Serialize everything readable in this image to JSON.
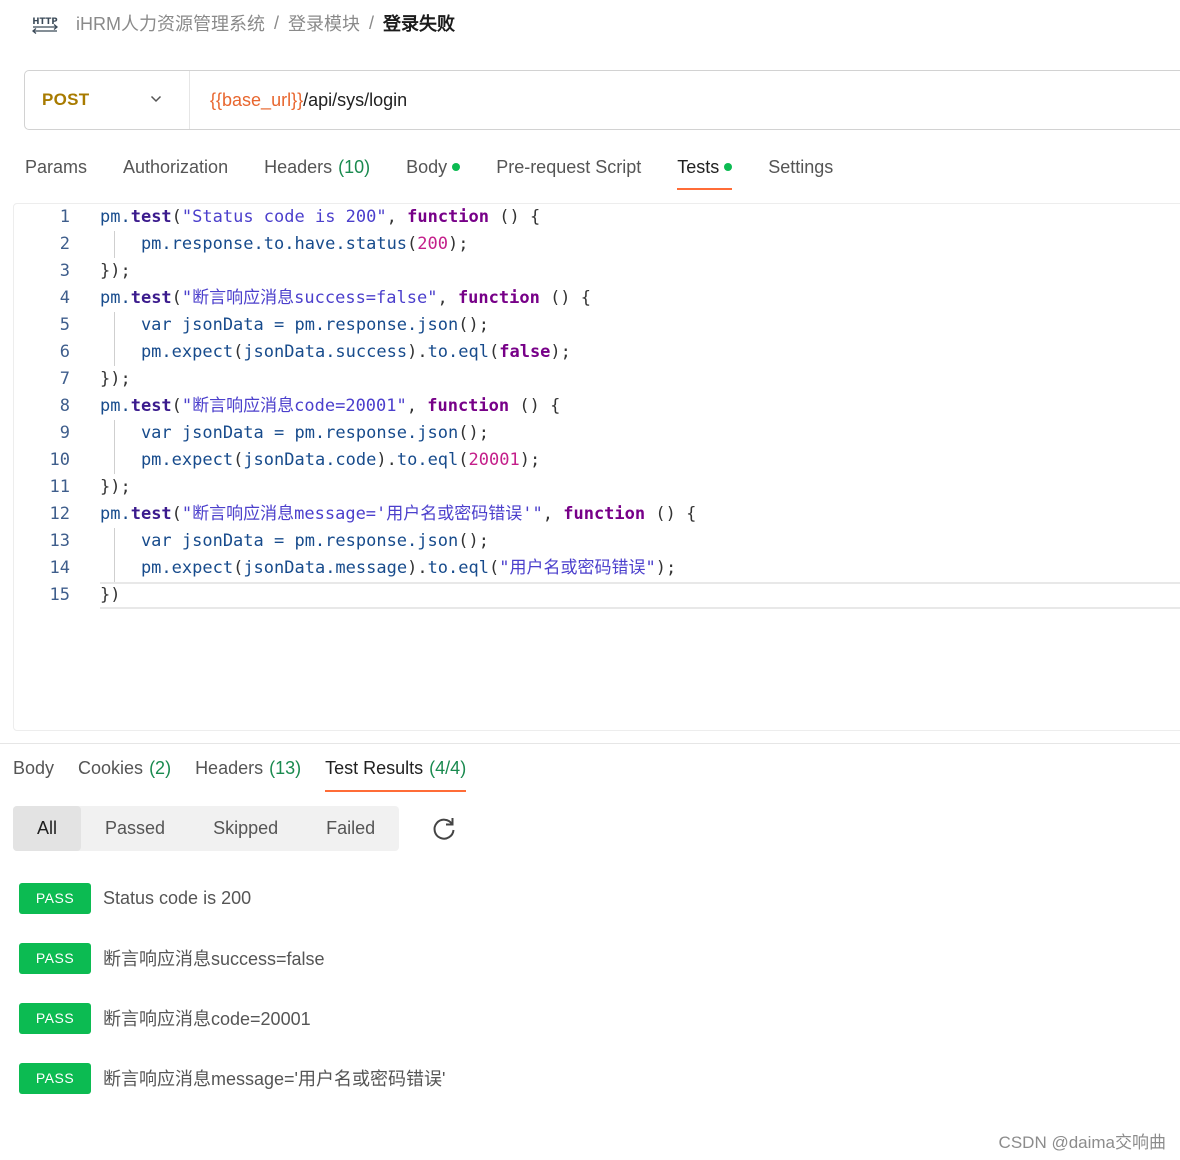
{
  "breadcrumb": {
    "icon": "http-icon",
    "items": [
      "iHRM人力资源管理系统",
      "登录模块"
    ],
    "separator": "/",
    "current": "登录失败"
  },
  "request": {
    "method": "POST",
    "url_variable": "{{base_url}}",
    "url_path": "/api/sys/login"
  },
  "request_tabs": [
    {
      "label": "Params"
    },
    {
      "label": "Authorization"
    },
    {
      "label": "Headers",
      "count": "(10)"
    },
    {
      "label": "Body",
      "dot": true
    },
    {
      "label": "Pre-request Script"
    },
    {
      "label": "Tests",
      "dot": true,
      "active": true
    },
    {
      "label": "Settings"
    }
  ],
  "code_lines": [
    {
      "n": "1",
      "tokens": [
        [
          "obj",
          "pm."
        ],
        [
          "fn",
          "test"
        ],
        [
          "punc",
          "("
        ],
        [
          "str",
          "\"Status code is 200\""
        ],
        [
          "punc",
          ", "
        ],
        [
          "kw",
          "function"
        ],
        [
          "punc",
          " () {"
        ]
      ]
    },
    {
      "n": "2",
      "tokens": [
        [
          "plain",
          "    pm.response.to.have.status"
        ],
        [
          "punc",
          "("
        ],
        [
          "num",
          "200"
        ],
        [
          "punc",
          ");"
        ]
      ]
    },
    {
      "n": "3",
      "tokens": [
        [
          "punc",
          "});"
        ]
      ]
    },
    {
      "n": "4",
      "tokens": [
        [
          "obj",
          "pm."
        ],
        [
          "fn",
          "test"
        ],
        [
          "punc",
          "("
        ],
        [
          "str",
          "\"断言响应消息success=false\""
        ],
        [
          "punc",
          ", "
        ],
        [
          "kw",
          "function"
        ],
        [
          "punc",
          " () {"
        ]
      ]
    },
    {
      "n": "5",
      "tokens": [
        [
          "plain",
          "    var jsonData = pm.response.json"
        ],
        [
          "punc",
          "();"
        ]
      ]
    },
    {
      "n": "6",
      "tokens": [
        [
          "plain",
          "    pm.expect"
        ],
        [
          "punc",
          "("
        ],
        [
          "plain",
          "jsonData.success"
        ],
        [
          "punc",
          ")."
        ],
        [
          "plain",
          "to.eql"
        ],
        [
          "punc",
          "("
        ],
        [
          "kw",
          "false"
        ],
        [
          "punc",
          ");"
        ]
      ]
    },
    {
      "n": "7",
      "tokens": [
        [
          "punc",
          "});"
        ]
      ]
    },
    {
      "n": "8",
      "tokens": [
        [
          "obj",
          "pm."
        ],
        [
          "fn",
          "test"
        ],
        [
          "punc",
          "("
        ],
        [
          "str",
          "\"断言响应消息code=20001\""
        ],
        [
          "punc",
          ", "
        ],
        [
          "kw",
          "function"
        ],
        [
          "punc",
          " () {"
        ]
      ]
    },
    {
      "n": "9",
      "tokens": [
        [
          "plain",
          "    var jsonData = pm.response.json"
        ],
        [
          "punc",
          "();"
        ]
      ]
    },
    {
      "n": "10",
      "tokens": [
        [
          "plain",
          "    pm.expect"
        ],
        [
          "punc",
          "("
        ],
        [
          "plain",
          "jsonData.code"
        ],
        [
          "punc",
          ")."
        ],
        [
          "plain",
          "to.eql"
        ],
        [
          "punc",
          "("
        ],
        [
          "num",
          "20001"
        ],
        [
          "punc",
          ");"
        ]
      ]
    },
    {
      "n": "11",
      "tokens": [
        [
          "punc",
          "});"
        ]
      ]
    },
    {
      "n": "12",
      "tokens": [
        [
          "obj",
          "pm."
        ],
        [
          "fn",
          "test"
        ],
        [
          "punc",
          "("
        ],
        [
          "str",
          "\"断言响应消息message='用户名或密码错误'\""
        ],
        [
          "punc",
          ", "
        ],
        [
          "kw",
          "function"
        ],
        [
          "punc",
          " () {"
        ]
      ]
    },
    {
      "n": "13",
      "tokens": [
        [
          "plain",
          "    var jsonData = pm.response.json"
        ],
        [
          "punc",
          "();"
        ]
      ]
    },
    {
      "n": "14",
      "tokens": [
        [
          "plain",
          "    pm.expect"
        ],
        [
          "punc",
          "("
        ],
        [
          "plain",
          "jsonData.message"
        ],
        [
          "punc",
          ")."
        ],
        [
          "plain",
          "to.eql"
        ],
        [
          "punc",
          "("
        ],
        [
          "str",
          "\"用户名或密码错误\""
        ],
        [
          "punc",
          ");"
        ]
      ]
    },
    {
      "n": "15",
      "tokens": [
        [
          "punc",
          "})"
        ]
      ]
    }
  ],
  "response_tabs": [
    {
      "label": "Body"
    },
    {
      "label": "Cookies",
      "count": "(2)"
    },
    {
      "label": "Headers",
      "count": "(13)"
    },
    {
      "label": "Test Results",
      "count": "(4/4)",
      "active": true
    }
  ],
  "filters": {
    "options": [
      "All",
      "Passed",
      "Skipped",
      "Failed"
    ],
    "selected": "All",
    "refresh_icon": "refresh-icon"
  },
  "results": [
    {
      "status": "PASS",
      "name": "Status code is 200"
    },
    {
      "status": "PASS",
      "name": "断言响应消息success=false"
    },
    {
      "status": "PASS",
      "name": "断言响应消息code=20001"
    },
    {
      "status": "PASS",
      "name": "断言响应消息message='用户名或密码错误'"
    }
  ],
  "watermark": "CSDN @daima交响曲",
  "colors": {
    "accent": "#ff6c37",
    "pass": "#0cbb52",
    "method": "#a87b00",
    "url_variable": "#e8662e"
  }
}
